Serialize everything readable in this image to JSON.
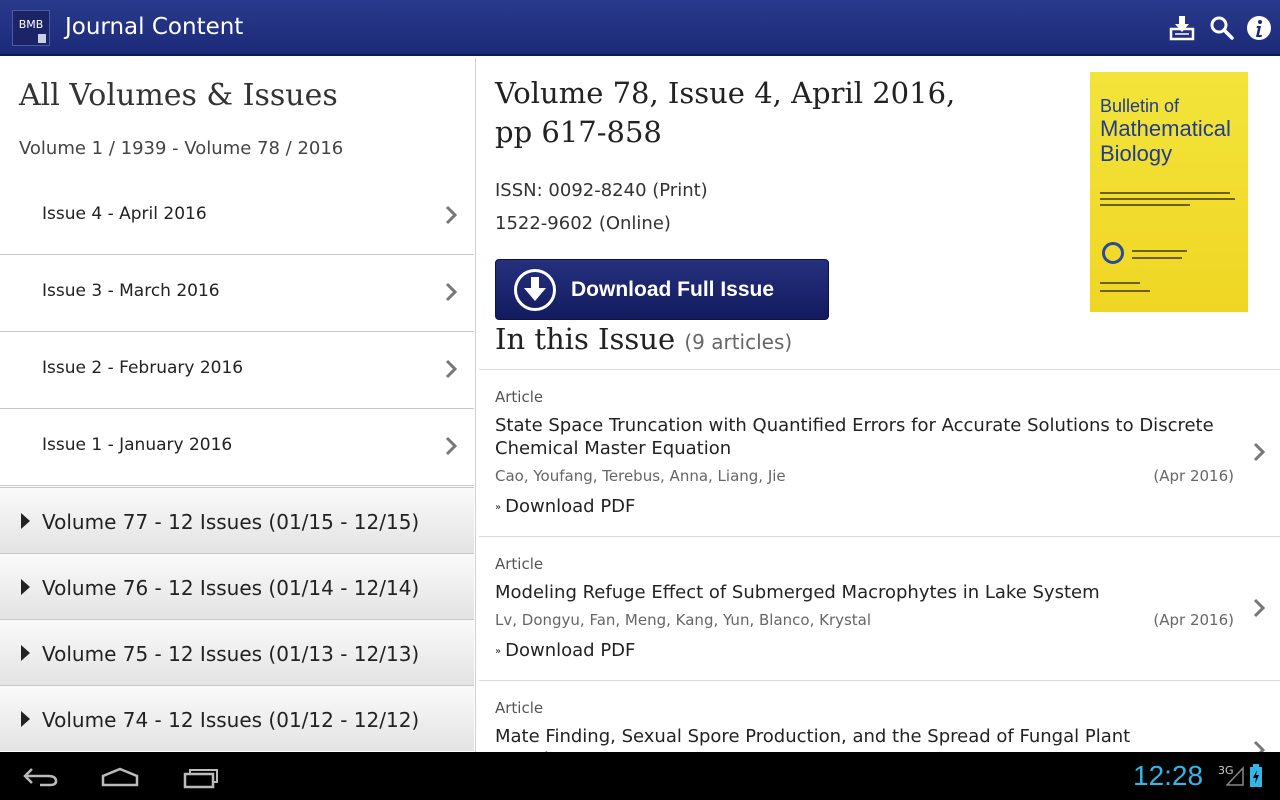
{
  "app": {
    "icon_text": "BMB",
    "title": "Journal Content",
    "actions": [
      "download-icon",
      "search-icon",
      "info-icon"
    ]
  },
  "left": {
    "title": "All Volumes & Issues",
    "range": "Volume 1 / 1939 - Volume 78 / 2016",
    "issues": [
      {
        "label": "Issue 4 - April 2016"
      },
      {
        "label": "Issue 3 - March 2016"
      },
      {
        "label": "Issue 2 - February 2016"
      },
      {
        "label": "Issue 1 - January 2016"
      }
    ],
    "volumes": [
      {
        "label": "Volume 77 - 12 Issues (01/15 - 12/15)"
      },
      {
        "label": "Volume 76 - 12 Issues (01/14 - 12/14)"
      },
      {
        "label": "Volume 75 - 12 Issues (01/13 - 12/13)"
      },
      {
        "label": "Volume 74 - 12 Issues (01/12 - 12/12)"
      }
    ]
  },
  "right": {
    "issue_title": "Volume 78, Issue 4, April 2016, pp 617-858",
    "issn_print": "ISSN: 0092-8240 (Print)",
    "issn_online": "1522-9602 (Online)",
    "download_full_label": "Download Full Issue",
    "cover": {
      "line1": "Bulletin of",
      "line2": "Mathematical",
      "line3": "Biology",
      "color": "#f0d624"
    },
    "in_issue_label": "In this Issue",
    "article_count": "(9 articles)",
    "articles": [
      {
        "type": "Article",
        "title": "State Space Truncation with Quantified Errors for Accurate Solutions to Discrete Chemical Master Equation",
        "authors": "Cao, Youfang, Terebus, Anna, Liang, Jie",
        "date": "(Apr 2016)",
        "download": "Download PDF"
      },
      {
        "type": "Article",
        "title": "Modeling Refuge Effect of Submerged Macrophytes in Lake System",
        "authors": "Lv, Dongyu, Fan, Meng, Kang, Yun, Blanco, Krystal",
        "date": "(Apr 2016)",
        "download": "Download PDF"
      },
      {
        "type": "Article",
        "title": "Mate Finding, Sexual Spore Production, and the Spread of Fungal Plant Parasites",
        "authors": "",
        "date": "",
        "download": ""
      }
    ]
  },
  "system": {
    "clock": "12:28",
    "network": "3G",
    "accent": "#33b5e5"
  }
}
